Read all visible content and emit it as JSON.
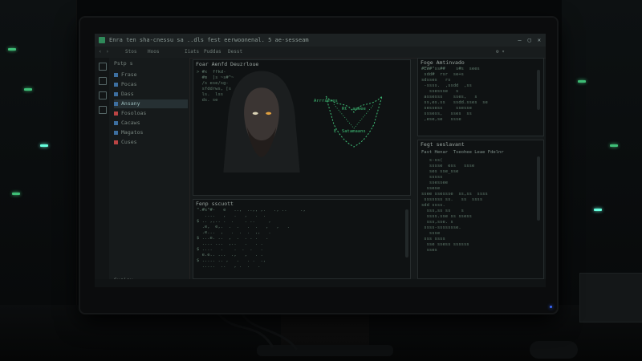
{
  "window": {
    "title": "Enra ten sha-cnessu sa ..dls fest eerwoonenal. 5  ae-sesseam",
    "controls": [
      "—",
      "▢",
      "✕"
    ]
  },
  "toolbar": {
    "items": [
      "Stos",
      "Hoos",
      "Iiats",
      "Puddas",
      "Desst"
    ]
  },
  "sidebar": {
    "header": "Pstp  s",
    "items": [
      "Frase",
      "Pocas",
      "Dass",
      "Ansany",
      "Fosoloas",
      "Cacaws",
      "Magatos",
      "Cuses"
    ],
    "footer": "Susisy"
  },
  "panels": {
    "image_panel_title": "Foar Aenfd Deuzrloue",
    "terminal_title": "Fenp  sscuott",
    "right_top_title": "Foge Amtinvado",
    "right_bottom_title": "Fegt  seslavant",
    "right_bottom_sub": "Fast Henar  Tseohee Leae Fdelnr"
  },
  "annotations": {
    "a1": "Arrrseres",
    "a2": "Rt  aaeee",
    "a3": "E  Satamaans"
  },
  "colors": {
    "accent_green": "#3fbf77",
    "code_dim": "#5f7a6c",
    "selection_blue": "#3d6fa0"
  }
}
